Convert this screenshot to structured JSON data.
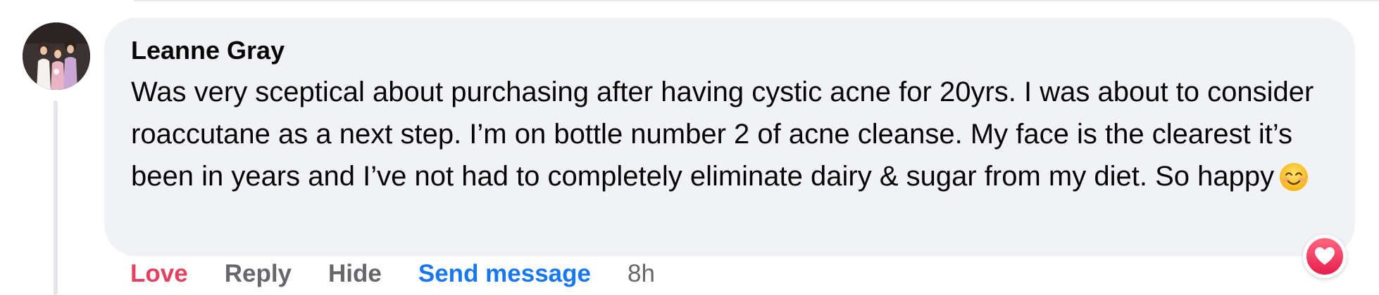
{
  "comment": {
    "author": "Leanne Gray",
    "text": "Was very sceptical about purchasing after having cystic acne for 20yrs. I was about to consider roaccutane as a next step. I’m on bottle number 2 of acne cleanse. My face is the clearest it’s been in years and I’ve not had to completely eliminate dairy & sugar from my diet. So happy",
    "emoji": "smiling-face-with-smiling-eyes-icon"
  },
  "actions": {
    "love": "Love",
    "reply": "Reply",
    "hide": "Hide",
    "send_message": "Send message",
    "timestamp": "8h"
  },
  "reaction": {
    "icon": "heart-icon",
    "color": "#f33e58"
  },
  "colors": {
    "bubble": "#f0f2f5",
    "love": "#e4405f",
    "muted": "#65676b",
    "link": "#1877f2"
  }
}
